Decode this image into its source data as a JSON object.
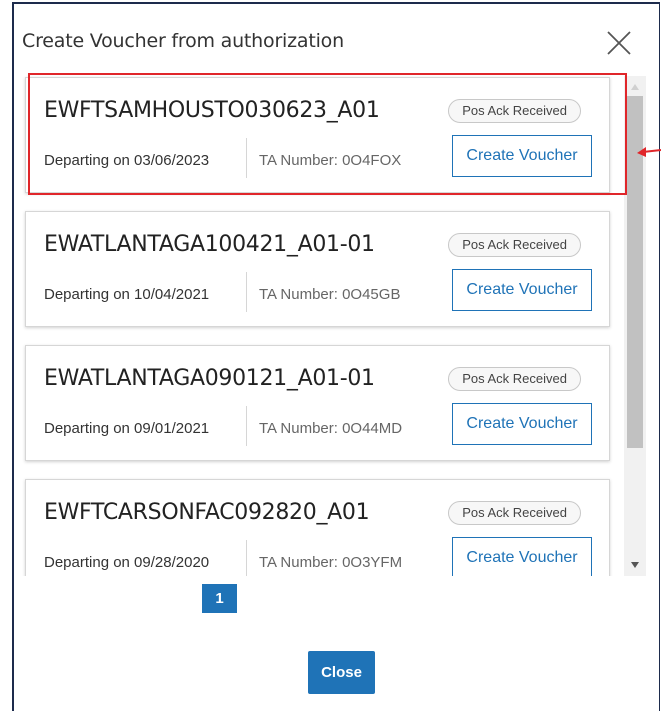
{
  "modal": {
    "title": "Create Voucher from authorization",
    "close_button": "Close"
  },
  "vouchers": [
    {
      "id": "EWFTSAMHOUSTO030623_A01",
      "status": "Pos Ack Received",
      "departing": "Departing on 03/06/2023",
      "ta": "TA Number: 0O4FOX",
      "action": "Create Voucher"
    },
    {
      "id": "EWATLANTAGA100421_A01-01",
      "status": "Pos Ack Received",
      "departing": "Departing on 10/04/2021",
      "ta": "TA Number: 0O45GB",
      "action": "Create Voucher"
    },
    {
      "id": "EWATLANTAGA090121_A01-01",
      "status": "Pos Ack Received",
      "departing": "Departing on 09/01/2021",
      "ta": "TA Number: 0O44MD",
      "action": "Create Voucher"
    },
    {
      "id": "EWFTCARSONFAC092820_A01",
      "status": "Pos Ack Received",
      "departing": "Departing on 09/28/2020",
      "ta": "TA Number: 0O3YFM",
      "action": "Create Voucher"
    }
  ],
  "pagination": {
    "current_page": "1"
  },
  "icons": {
    "close": "close-icon",
    "annotation": "arrow-icon",
    "scroll_up": "caret-up-icon",
    "scroll_down": "caret-down-icon"
  },
  "colors": {
    "accent": "#1f73b7",
    "highlight": "#e0262a",
    "border": "#1d2b4c"
  }
}
